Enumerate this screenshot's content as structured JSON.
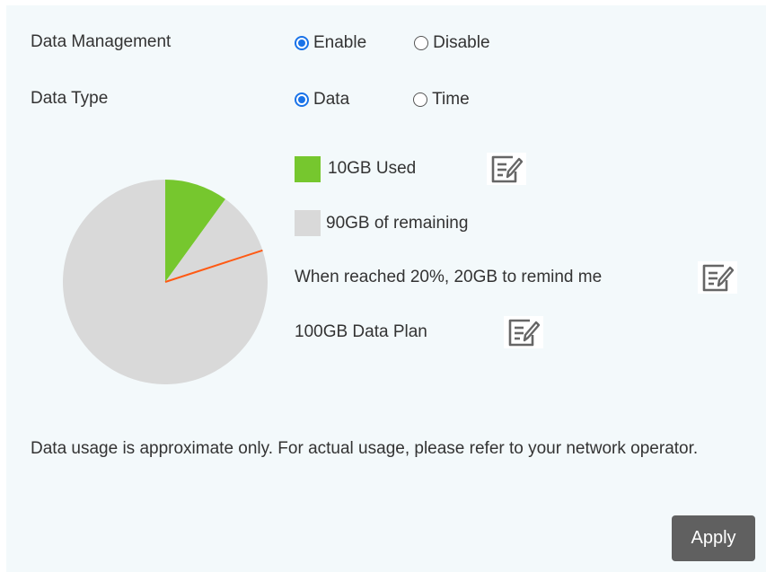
{
  "data_management": {
    "label": "Data Management",
    "options": [
      "Enable",
      "Disable"
    ],
    "selected": "Enable"
  },
  "data_type": {
    "label": "Data Type",
    "options": [
      "Data",
      "Time"
    ],
    "selected": "Data"
  },
  "usage": {
    "used_label": "10GB Used",
    "remaining_label": "90GB of remaining",
    "reminder_text": "When reached 20%, 20GB to remind me",
    "plan_text": "100GB Data Plan"
  },
  "chart_data": {
    "type": "pie",
    "slices": [
      {
        "name": "10GB Used",
        "value": 10,
        "color": "#76c72e"
      },
      {
        "name": "90GB of remaining",
        "value": 90,
        "color": "#d9d9d9"
      }
    ],
    "reminder_marker_percent": 20,
    "reminder_marker_color": "#ff5a14"
  },
  "note": "Data usage is approximate only. For actual usage, please refer to your network operator.",
  "apply_label": "Apply",
  "colors": {
    "accent": "#1a73e8",
    "apply_button": "#606060",
    "icon": "#666666"
  }
}
